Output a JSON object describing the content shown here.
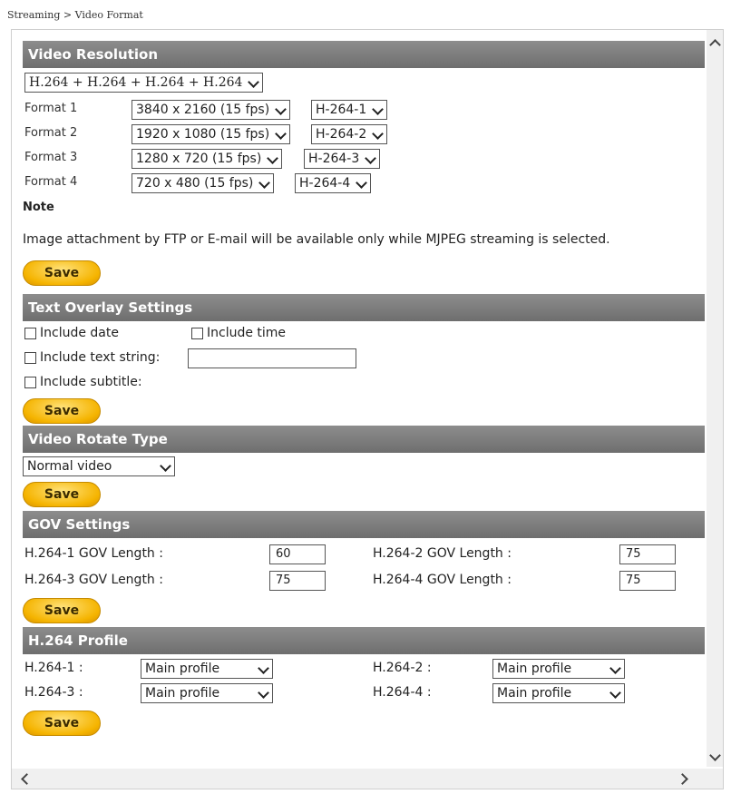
{
  "breadcrumb": "Streaming > Video Format",
  "video_resolution": {
    "title": "Video Resolution",
    "combo": "H.264 + H.264 + H.264 + H.264",
    "formats": [
      {
        "label": "Format 1",
        "resolution": "3840 x 2160 (15 fps)",
        "codec": "H-264-1"
      },
      {
        "label": "Format 2",
        "resolution": "1920 x 1080 (15 fps)",
        "codec": "H-264-2"
      },
      {
        "label": "Format 3",
        "resolution": "1280 x 720 (15 fps)",
        "codec": "H-264-3"
      },
      {
        "label": "Format 4",
        "resolution": "720 x 480 (15 fps)",
        "codec": "H-264-4"
      }
    ],
    "note_label": "Note",
    "note_text": "Image attachment by FTP or E-mail will be available only while MJPEG streaming is selected.",
    "save": "Save"
  },
  "text_overlay": {
    "title": "Text Overlay Settings",
    "include_date": "Include date",
    "include_time": "Include time",
    "include_text_string": "Include text string:",
    "text_string_value": "",
    "include_subtitle": "Include subtitle:",
    "save": "Save"
  },
  "video_rotate": {
    "title": "Video Rotate Type",
    "value": "Normal video",
    "save": "Save"
  },
  "gov": {
    "title": "GOV Settings",
    "items": [
      {
        "label": "H.264-1 GOV Length :",
        "value": "60"
      },
      {
        "label": "H.264-2 GOV Length :",
        "value": "75"
      },
      {
        "label": "H.264-3 GOV Length :",
        "value": "75"
      },
      {
        "label": "H.264-4 GOV Length :",
        "value": "75"
      }
    ],
    "save": "Save"
  },
  "profile": {
    "title": "H.264 Profile",
    "items": [
      {
        "label": "H.264-1 :",
        "value": "Main profile"
      },
      {
        "label": "H.264-2 :",
        "value": "Main profile"
      },
      {
        "label": "H.264-3 :",
        "value": "Main profile"
      },
      {
        "label": "H.264-4 :",
        "value": "Main profile"
      }
    ],
    "save": "Save"
  },
  "colors": {
    "header": "#7a7a7a",
    "save_button": "#f5b400"
  },
  "icons": [
    "chevron-down-icon",
    "scroll-up-arrow-icon",
    "scroll-down-arrow-icon",
    "scroll-left-arrow-icon",
    "scroll-right-arrow-icon"
  ]
}
